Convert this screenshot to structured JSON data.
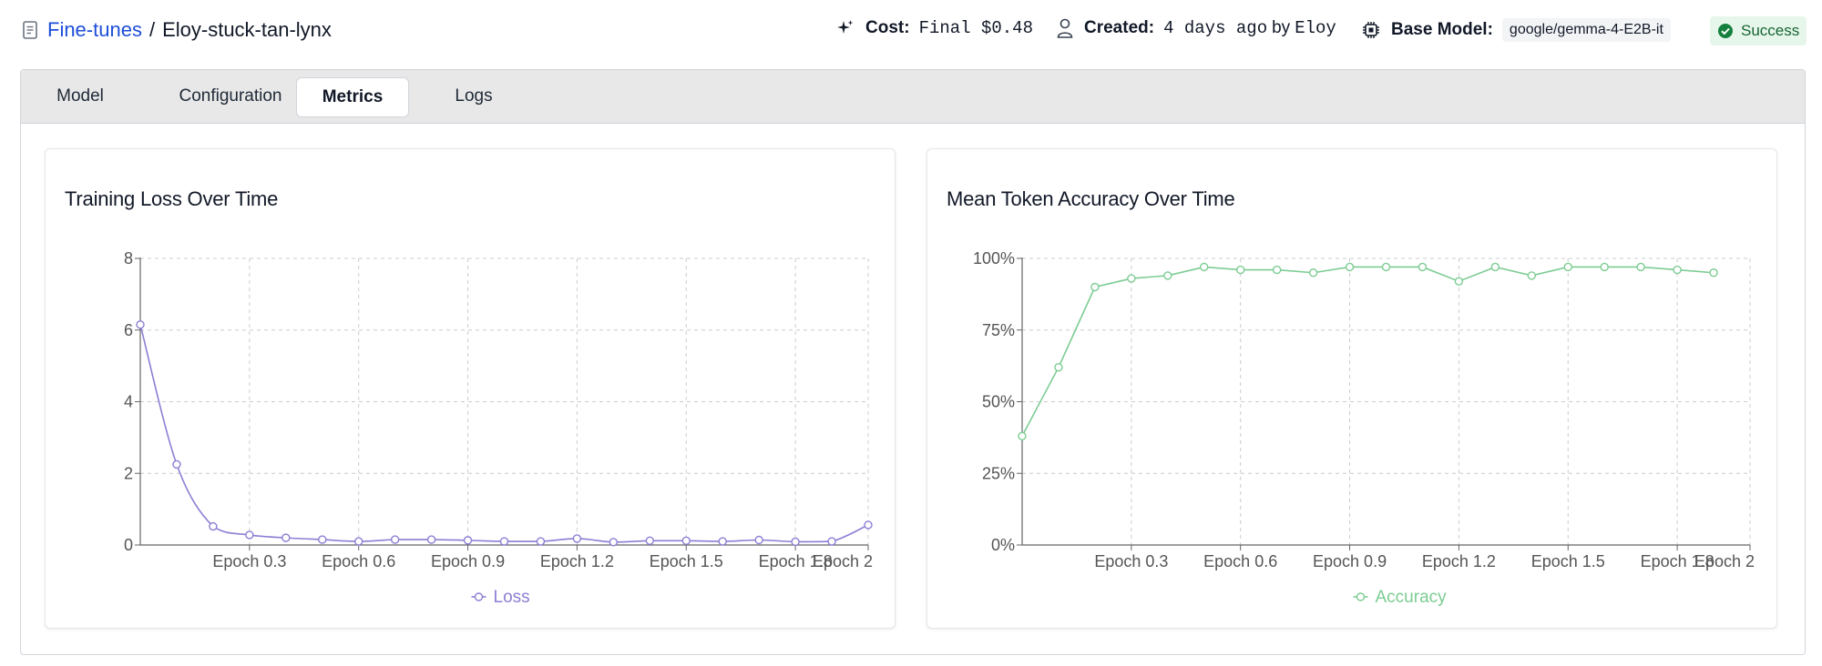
{
  "breadcrumb": {
    "parent": "Fine-tunes",
    "separator": "/",
    "current": "Eloy-stuck-tan-lynx"
  },
  "meta": {
    "cost_label": "Cost:",
    "cost_value": "Final $0.48",
    "created_label": "Created:",
    "created_value": "4 days ago",
    "created_by_word": "by",
    "created_by": "Eloy",
    "base_model_label": "Base Model:",
    "base_model_value": "google/gemma-4-E2B-it",
    "status": "Success"
  },
  "tabs": [
    {
      "label": "Model",
      "active": false
    },
    {
      "label": "Configuration",
      "active": false
    },
    {
      "label": "Metrics",
      "active": true
    },
    {
      "label": "Logs",
      "active": false
    }
  ],
  "colors": {
    "link": "#1d4ed8",
    "loss": "#8b7fd4",
    "accuracy": "#7dcc93",
    "success": "#16a34a"
  },
  "chart_data": [
    {
      "type": "line",
      "title": "Training Loss Over Time",
      "x": [
        0.0,
        0.1,
        0.2,
        0.3,
        0.4,
        0.5,
        0.6,
        0.7,
        0.8,
        0.9,
        1.0,
        1.1,
        1.2,
        1.3,
        1.4,
        1.5,
        1.6,
        1.7,
        1.8,
        1.9,
        2.0
      ],
      "x_ticks": [
        {
          "value": 0.3,
          "label": "Epoch 0.3"
        },
        {
          "value": 0.6,
          "label": "Epoch 0.6"
        },
        {
          "value": 0.9,
          "label": "Epoch 0.9"
        },
        {
          "value": 1.2,
          "label": "Epoch 1.2"
        },
        {
          "value": 1.5,
          "label": "Epoch 1.5"
        },
        {
          "value": 1.8,
          "label": "Epoch 1.8"
        },
        {
          "value": 2.0,
          "label": "Epoch 2"
        }
      ],
      "series": [
        {
          "name": "Loss",
          "values": [
            6.15,
            2.25,
            0.52,
            0.28,
            0.2,
            0.15,
            0.1,
            0.15,
            0.15,
            0.13,
            0.1,
            0.1,
            0.18,
            0.08,
            0.12,
            0.12,
            0.1,
            0.14,
            0.09,
            0.1,
            0.56
          ]
        }
      ],
      "ylim": [
        0,
        8
      ],
      "y_ticks": [
        {
          "value": 0,
          "label": "0"
        },
        {
          "value": 2,
          "label": "2"
        },
        {
          "value": 4,
          "label": "4"
        },
        {
          "value": 6,
          "label": "6"
        },
        {
          "value": 8,
          "label": "8"
        }
      ],
      "grid": true,
      "legend": "bottom",
      "curve": "smooth"
    },
    {
      "type": "line",
      "title": "Mean Token Accuracy Over Time",
      "x": [
        0.0,
        0.1,
        0.2,
        0.3,
        0.4,
        0.5,
        0.6,
        0.7,
        0.8,
        0.9,
        1.0,
        1.1,
        1.2,
        1.3,
        1.4,
        1.5,
        1.6,
        1.7,
        1.8,
        1.9,
        2.0
      ],
      "x_ticks": [
        {
          "value": 0.3,
          "label": "Epoch 0.3"
        },
        {
          "value": 0.6,
          "label": "Epoch 0.6"
        },
        {
          "value": 0.9,
          "label": "Epoch 0.9"
        },
        {
          "value": 1.2,
          "label": "Epoch 1.2"
        },
        {
          "value": 1.5,
          "label": "Epoch 1.5"
        },
        {
          "value": 1.8,
          "label": "Epoch 1.8"
        },
        {
          "value": 2.0,
          "label": "Epoch 2"
        }
      ],
      "series": [
        {
          "name": "Accuracy",
          "values": [
            38,
            62,
            90,
            93,
            94,
            97,
            96,
            96,
            95,
            97,
            97,
            97,
            92,
            97,
            94,
            97,
            97,
            97,
            96,
            95
          ]
        }
      ],
      "ylim": [
        0,
        100
      ],
      "y_ticks": [
        {
          "value": 0,
          "label": "0%"
        },
        {
          "value": 25,
          "label": "25%"
        },
        {
          "value": 50,
          "label": "50%"
        },
        {
          "value": 75,
          "label": "75%"
        },
        {
          "value": 100,
          "label": "100%"
        }
      ],
      "grid": true,
      "legend": "bottom",
      "curve": "linear"
    }
  ]
}
